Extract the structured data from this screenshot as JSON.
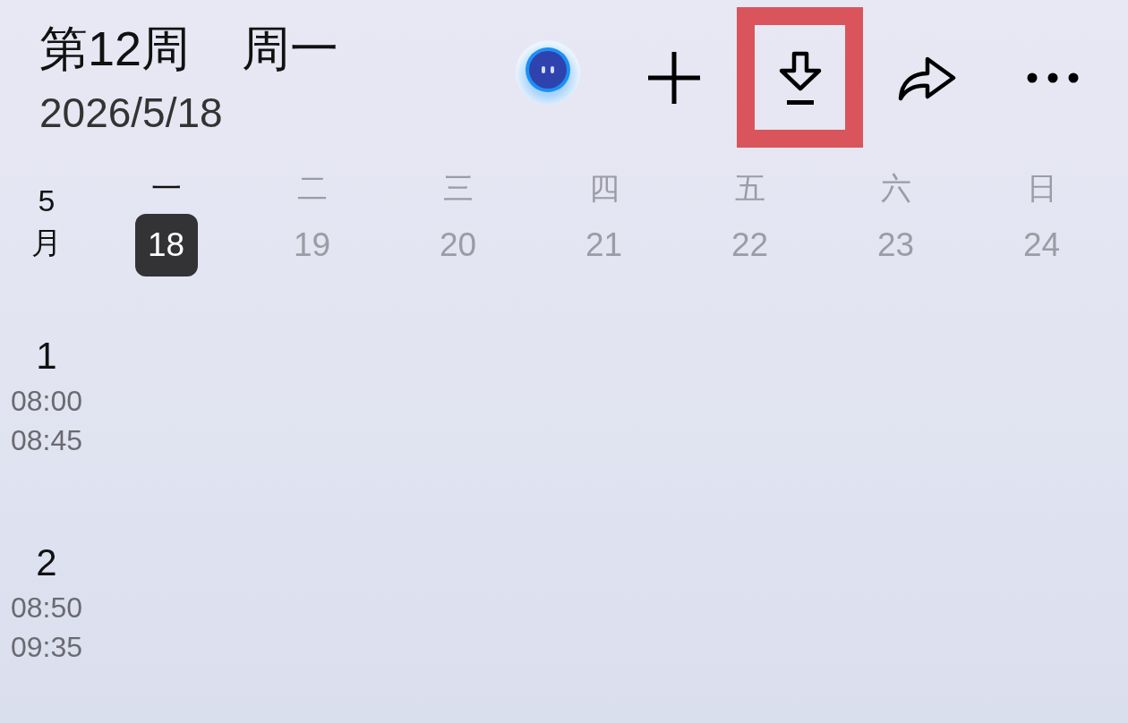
{
  "header": {
    "week": "第12周",
    "weekday": "周一",
    "date": "2026/5/18"
  },
  "actions": [
    {
      "kind": "assistant",
      "highlighted": false
    },
    {
      "kind": "add",
      "highlighted": false
    },
    {
      "kind": "download",
      "highlighted": true
    },
    {
      "kind": "share",
      "highlighted": false
    },
    {
      "kind": "more",
      "highlighted": false
    }
  ],
  "week": {
    "month": "5月",
    "days": [
      {
        "weekday": "一",
        "date": "18",
        "selected": true
      },
      {
        "weekday": "二",
        "date": "19",
        "selected": false
      },
      {
        "weekday": "三",
        "date": "20",
        "selected": false
      },
      {
        "weekday": "四",
        "date": "21",
        "selected": false
      },
      {
        "weekday": "五",
        "date": "22",
        "selected": false
      },
      {
        "weekday": "六",
        "date": "23",
        "selected": false
      },
      {
        "weekday": "日",
        "date": "24",
        "selected": false
      }
    ]
  },
  "periods": [
    {
      "number": "1",
      "start": "08:00",
      "end": "08:45"
    },
    {
      "number": "2",
      "start": "08:50",
      "end": "09:35"
    }
  ]
}
